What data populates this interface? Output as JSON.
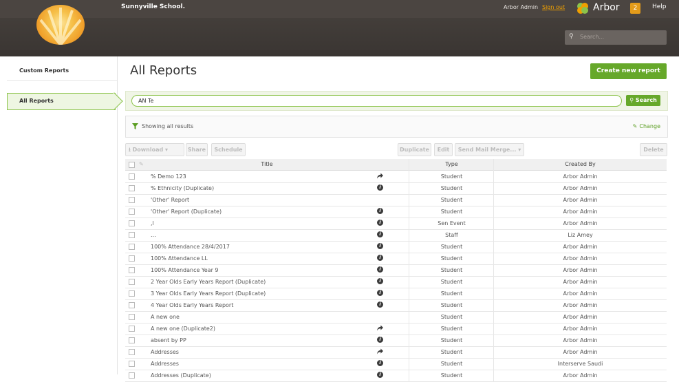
{
  "header": {
    "school_name": "Sunnyville School.",
    "user": "Arbor Admin",
    "signout": "Sign out",
    "brand": "Arbor",
    "notifications": "2",
    "help": "Help",
    "search_placeholder": "Search..."
  },
  "sidebar": {
    "items": [
      {
        "label": "Custom Reports"
      },
      {
        "label": "All Reports"
      }
    ]
  },
  "main": {
    "title": "All Reports",
    "create_button": "Create new report",
    "search_value": "AN Te",
    "search_button": "Search",
    "filter_text": "Showing all results",
    "change_link": "Change",
    "toolbar": {
      "download": "Download ▾",
      "share": "Share",
      "schedule": "Schedule",
      "duplicate": "Duplicate",
      "edit": "Edit",
      "send_mail_merge": "Send Mail Merge... ▾",
      "delete": "Delete"
    },
    "columns": {
      "title": "Title",
      "type": "Type",
      "created_by": "Created By"
    },
    "rows": [
      {
        "title": "% Demo 123",
        "icon": "share",
        "type": "Student",
        "created_by": "Arbor Admin"
      },
      {
        "title": "% Ethnicity (Duplicate)",
        "icon": "info",
        "type": "Student",
        "created_by": "Arbor Admin"
      },
      {
        "title": "'Other' Report",
        "icon": "",
        "type": "Student",
        "created_by": "Arbor Admin"
      },
      {
        "title": "'Other' Report (Duplicate)",
        "icon": "info",
        "type": "Student",
        "created_by": "Arbor Admin"
      },
      {
        "title": ",l",
        "icon": "info",
        "type": "Sen Event",
        "created_by": "Arbor Admin"
      },
      {
        "title": "...",
        "icon": "info",
        "type": "Staff",
        "created_by": "Liz Amey"
      },
      {
        "title": "100% Attendance 28/4/2017",
        "icon": "info",
        "type": "Student",
        "created_by": "Arbor Admin"
      },
      {
        "title": "100% Attendance LL",
        "icon": "info",
        "type": "Student",
        "created_by": "Arbor Admin"
      },
      {
        "title": "100% Attendance Year 9",
        "icon": "info",
        "type": "Student",
        "created_by": "Arbor Admin"
      },
      {
        "title": "2 Year Olds Early Years Report (Duplicate)",
        "icon": "info",
        "type": "Student",
        "created_by": "Arbor Admin"
      },
      {
        "title": "3 Year Olds Early Years Report (Duplicate)",
        "icon": "info",
        "type": "Student",
        "created_by": "Arbor Admin"
      },
      {
        "title": "4 Year Olds Early Years Report",
        "icon": "info",
        "type": "Student",
        "created_by": "Arbor Admin"
      },
      {
        "title": "A new one",
        "icon": "",
        "type": "Student",
        "created_by": "Arbor Admin"
      },
      {
        "title": "A new one (Duplicate2)",
        "icon": "share",
        "type": "Student",
        "created_by": "Arbor Admin"
      },
      {
        "title": "absent by PP",
        "icon": "info",
        "type": "Student",
        "created_by": "Arbor Admin"
      },
      {
        "title": "Addresses",
        "icon": "share",
        "type": "Student",
        "created_by": "Arbor Admin"
      },
      {
        "title": "Addresses",
        "icon": "info",
        "type": "Student",
        "created_by": "Interserve Saudi"
      },
      {
        "title": "Addresses (Duplicate)",
        "icon": "info",
        "type": "Student",
        "created_by": "Arbor Admin"
      }
    ]
  },
  "colors": {
    "accent": "#66a82a",
    "header": "#4b4541",
    "link": "#f0a000"
  }
}
